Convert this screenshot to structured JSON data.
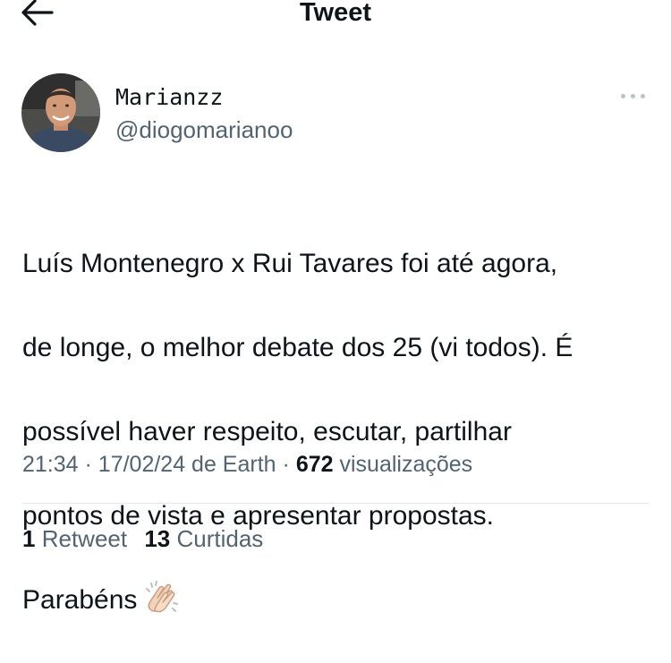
{
  "header": {
    "title": "Tweet",
    "back_icon": "arrow-left-icon"
  },
  "author": {
    "display_name": "Marianzz",
    "handle": "@diogomarianoo"
  },
  "more_icon": "more-horizontal-icon",
  "tweet": {
    "lines": [
      "Luís Montenegro x Rui Tavares foi até agora,",
      "de longe, o melhor debate dos 25 (vi todos). É",
      "possível haver respeito, escutar, partilhar",
      "pontos de vista e apresentar propostas.",
      "Parabéns"
    ],
    "emoji": "👏🏻"
  },
  "meta": {
    "time": "21:34",
    "separator": "·",
    "date_source": "17/02/24 de Earth",
    "views_count": "672",
    "views_label": "visualizações"
  },
  "stats": {
    "retweets_count": "1",
    "retweets_label": "Retweet",
    "likes_count": "13",
    "likes_label": "Curtidas"
  },
  "colors": {
    "text_primary": "#0f1419",
    "text_secondary": "#536471",
    "divider": "#e6e9eb"
  }
}
